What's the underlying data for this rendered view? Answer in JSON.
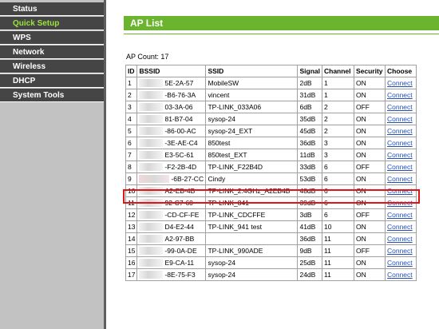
{
  "nav": {
    "items": [
      {
        "label": "Status",
        "active": false
      },
      {
        "label": "Quick Setup",
        "active": true
      },
      {
        "label": "WPS",
        "active": false
      },
      {
        "label": "Network",
        "active": false
      },
      {
        "label": "Wireless",
        "active": false
      },
      {
        "label": "DHCP",
        "active": false
      },
      {
        "label": "System Tools",
        "active": false
      }
    ]
  },
  "page": {
    "title": "AP List",
    "ap_count": "AP Count: 17"
  },
  "table": {
    "headers": [
      "ID",
      "BSSID",
      "SSID",
      "Signal",
      "Channel",
      "Security",
      "Choose"
    ],
    "rows": [
      {
        "id": "1",
        "bssid": "5E-2A-57",
        "ssid": "MobileSW",
        "signal": "2dB",
        "channel": "1",
        "security": "ON",
        "choose": "Connect"
      },
      {
        "id": "2",
        "bssid": "-B6-76-3A",
        "ssid": "vincent",
        "signal": "31dB",
        "channel": "1",
        "security": "ON",
        "choose": "Connect"
      },
      {
        "id": "3",
        "bssid": "03-3A-06",
        "ssid": "TP-LINK_033A06",
        "signal": "6dB",
        "channel": "2",
        "security": "OFF",
        "choose": "Connect"
      },
      {
        "id": "4",
        "bssid": "81-B7-04",
        "ssid": "sysop-24",
        "signal": "35dB",
        "channel": "2",
        "security": "ON",
        "choose": "Connect"
      },
      {
        "id": "5",
        "bssid": "-86-00-AC",
        "ssid": "sysop-24_EXT",
        "signal": "45dB",
        "channel": "2",
        "security": "ON",
        "choose": "Connect"
      },
      {
        "id": "6",
        "bssid": "-3E-AE-C4",
        "ssid": "850test",
        "signal": "36dB",
        "channel": "3",
        "security": "ON",
        "choose": "Connect"
      },
      {
        "id": "7",
        "bssid": "E3-5C-61",
        "ssid": "850test_EXT",
        "signal": "11dB",
        "channel": "3",
        "security": "ON",
        "choose": "Connect"
      },
      {
        "id": "8",
        "bssid": "-F2-2B-4D",
        "ssid": "TP-LINK_F22B4D",
        "signal": "33dB",
        "channel": "6",
        "security": "OFF",
        "choose": "Connect"
      },
      {
        "id": "9",
        "bssid": "-6B-27-CC",
        "ssid": "Cindy",
        "signal": "53dB",
        "channel": "6",
        "security": "ON",
        "choose": "Connect"
      },
      {
        "id": "10",
        "bssid": "A2-EB-4B",
        "ssid": "TP-LINK_2.4GHz_A2EB4B",
        "signal": "48dB",
        "channel": "6",
        "security": "ON",
        "choose": "Connect"
      },
      {
        "id": "11",
        "bssid": "92-C7-60",
        "ssid": "TP-LINK_841",
        "signal": "39dB",
        "channel": "6",
        "security": "ON",
        "choose": "Connect"
      },
      {
        "id": "12",
        "bssid": "-CD-CF-FE",
        "ssid": "TP-LINK_CDCFFE",
        "signal": "3dB",
        "channel": "6",
        "security": "OFF",
        "choose": "Connect"
      },
      {
        "id": "13",
        "bssid": "D4-E2-44",
        "ssid": "TP-LINK_941 test",
        "signal": "41dB",
        "channel": "10",
        "security": "ON",
        "choose": "Connect"
      },
      {
        "id": "14",
        "bssid": "A2-97-BB",
        "ssid": "",
        "signal": "36dB",
        "channel": "11",
        "security": "ON",
        "choose": "Connect"
      },
      {
        "id": "15",
        "bssid": "-99-0A-DE",
        "ssid": "TP-LINK_990ADE",
        "signal": "9dB",
        "channel": "11",
        "security": "OFF",
        "choose": "Connect"
      },
      {
        "id": "16",
        "bssid": "E9-CA-11",
        "ssid": "sysop-24",
        "signal": "25dB",
        "channel": "11",
        "security": "ON",
        "choose": "Connect"
      },
      {
        "id": "17",
        "bssid": "-8E-75-F3",
        "ssid": "sysop-24",
        "signal": "24dB",
        "channel": "11",
        "security": "ON",
        "choose": "Connect"
      }
    ]
  },
  "colors": {
    "accent": "#6ab42e",
    "nav_bg": "#454545",
    "nav_active_text": "#9be43c",
    "link": "#1f4fbf",
    "highlight": "#e11414"
  }
}
